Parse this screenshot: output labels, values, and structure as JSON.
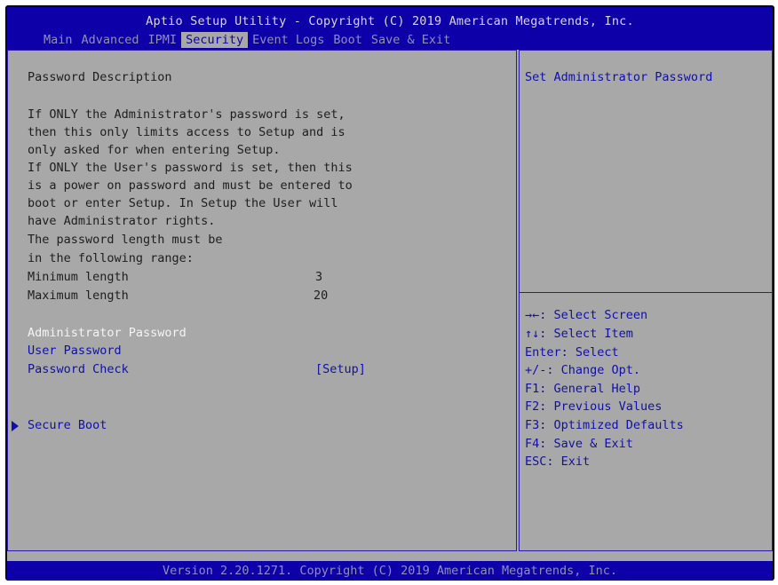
{
  "header": {
    "title": "Aptio Setup Utility - Copyright (C) 2019 American Megatrends, Inc.",
    "tabs": [
      "Main",
      "Advanced",
      "IPMI",
      "Security",
      "Event Logs",
      "Boot",
      "Save & Exit"
    ],
    "active_tab": "Security"
  },
  "left": {
    "heading": "Password Description",
    "description": [
      "If ONLY the Administrator's password is set,",
      "then this only limits access to Setup and is",
      "only asked for when entering Setup.",
      "If ONLY the User's password is set, then this",
      "is a power on password and must be entered to",
      "boot or enter Setup. In Setup the User will",
      "have Administrator rights.",
      "The password length must be",
      "in the following range:"
    ],
    "min_label": "Minimum length",
    "min_value": "3",
    "max_label": "Maximum length",
    "max_value": "20",
    "admin_password": "Administrator Password",
    "user_password": "User Password",
    "password_check_label": "Password Check",
    "password_check_value": "[Setup]",
    "secure_boot": "Secure Boot"
  },
  "right": {
    "help_text": "Set Administrator Password",
    "keys": [
      "→←: Select Screen",
      "↑↓: Select Item",
      "Enter: Select",
      "+/-: Change Opt.",
      "F1: General Help",
      "F2: Previous Values",
      "F3: Optimized Defaults",
      "F4: Save & Exit",
      "ESC: Exit"
    ]
  },
  "footer": {
    "text": "Version 2.20.1271. Copyright (C) 2019 American Megatrends, Inc."
  },
  "colors": {
    "header_bg": "#0e00a8",
    "panel_bg": "#a8a8a8",
    "selected_text": "#f4f4f4",
    "link_text": "#1010a8"
  }
}
